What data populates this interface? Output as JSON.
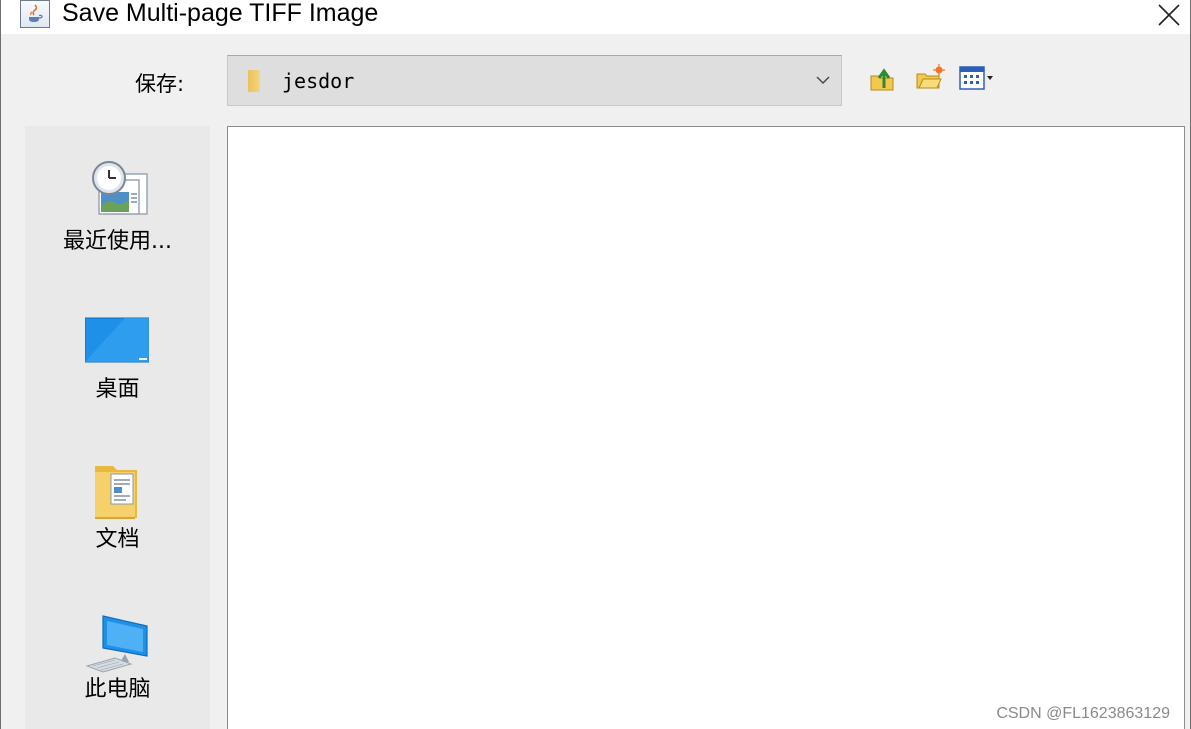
{
  "window": {
    "title": "Save Multi-page TIFF Image"
  },
  "save_in": {
    "label": "保存:",
    "folder": "jesdor"
  },
  "toolbar": {
    "buttons": [
      "up-one-level-icon",
      "new-folder-icon",
      "view-menu-icon"
    ]
  },
  "places": [
    {
      "label": "最近使用...",
      "icon": "recent-items-icon"
    },
    {
      "label": "桌面",
      "icon": "desktop-icon"
    },
    {
      "label": "文档",
      "icon": "documents-icon"
    },
    {
      "label": "此电脑",
      "icon": "this-pc-icon"
    }
  ],
  "watermark": "CSDN @FL1623863129",
  "colors": {
    "window_bg": "#f0f0f0",
    "list_bg": "#ffffff",
    "combo_bg": "#dedede",
    "desktop_blue": "#1e90e8"
  }
}
